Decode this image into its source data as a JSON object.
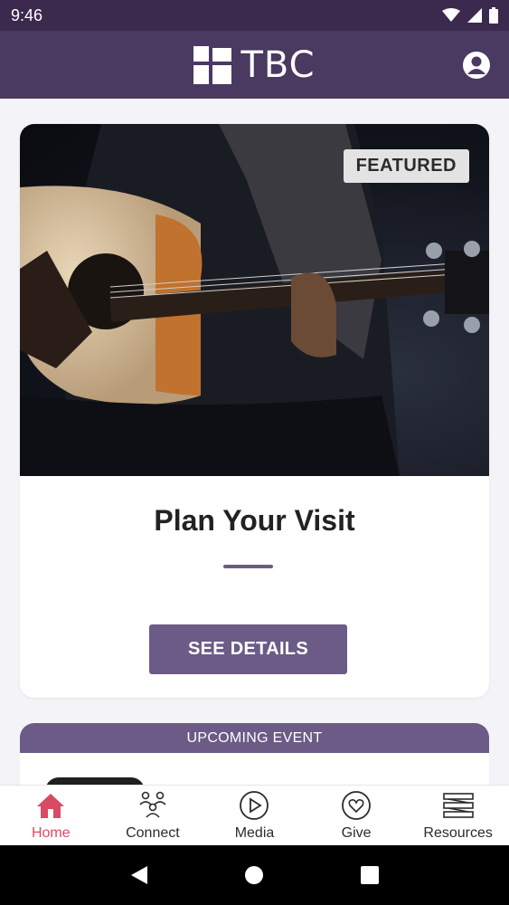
{
  "status_bar": {
    "time": "9:46"
  },
  "header": {
    "logo_text": "TBC"
  },
  "featured": {
    "badge": "FEATURED",
    "title": "Plan Your Visit",
    "button_label": "SEE DETAILS"
  },
  "event": {
    "header": "UPCOMING EVENT"
  },
  "bottom_nav": {
    "items": [
      {
        "label": "Home",
        "icon": "home-icon"
      },
      {
        "label": "Connect",
        "icon": "people-icon"
      },
      {
        "label": "Media",
        "icon": "play-icon"
      },
      {
        "label": "Give",
        "icon": "heart-icon"
      },
      {
        "label": "Resources",
        "icon": "resources-icon"
      }
    ]
  },
  "colors": {
    "header": "#4a3960",
    "accent": "#6b5b86",
    "active_tab": "#d94a63"
  }
}
